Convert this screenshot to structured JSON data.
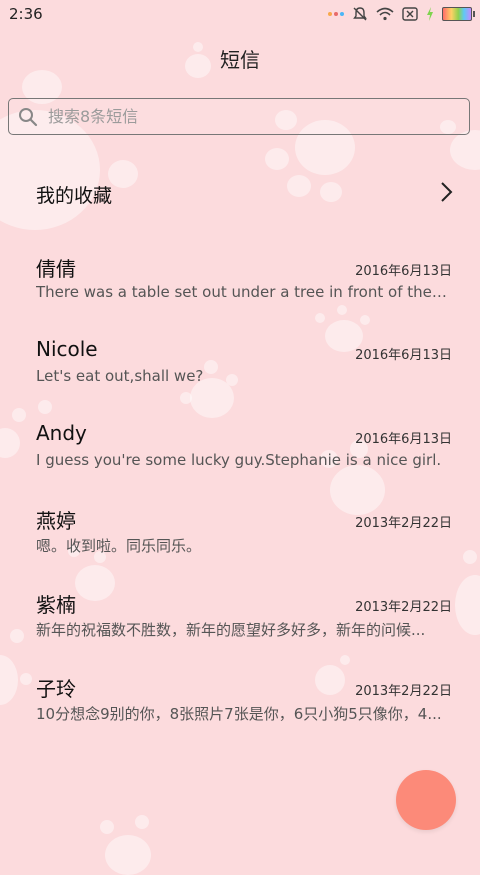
{
  "status_bar": {
    "time": "2:36",
    "icons": [
      "notification-dots-icon",
      "mute-bell-icon",
      "wifi-icon",
      "no-sim-icon",
      "charging-icon",
      "battery-icon"
    ]
  },
  "header": {
    "title": "短信"
  },
  "search": {
    "placeholder": "搜索8条短信",
    "value": ""
  },
  "favorites": {
    "label": "我的收藏"
  },
  "messages": [
    {
      "name": "倩倩",
      "date": "2016年6月13日",
      "preview": "There was a table set out under a tree in front of the ho..."
    },
    {
      "name": "Nicole",
      "date": "2016年6月13日",
      "preview": "Let's eat out,shall we?"
    },
    {
      "name": "Andy",
      "date": "2016年6月13日",
      "preview": "I guess you're some lucky guy.Stephanie is a nice girl."
    },
    {
      "name": "燕婷",
      "date": "2013年2月22日",
      "preview": "嗯。收到啦。同乐同乐。"
    },
    {
      "name": "紫楠",
      "date": "2013年2月22日",
      "preview": "新年的祝福数不胜数，新年的愿望好多好多，新年的问候..."
    },
    {
      "name": "子玲",
      "date": "2013年2月22日",
      "preview": "10分想念9别的你，8张照片7张是你，6只小狗5只像你，4..."
    }
  ],
  "colors": {
    "background": "#fcdbdd",
    "fab": "#fc8a79"
  }
}
